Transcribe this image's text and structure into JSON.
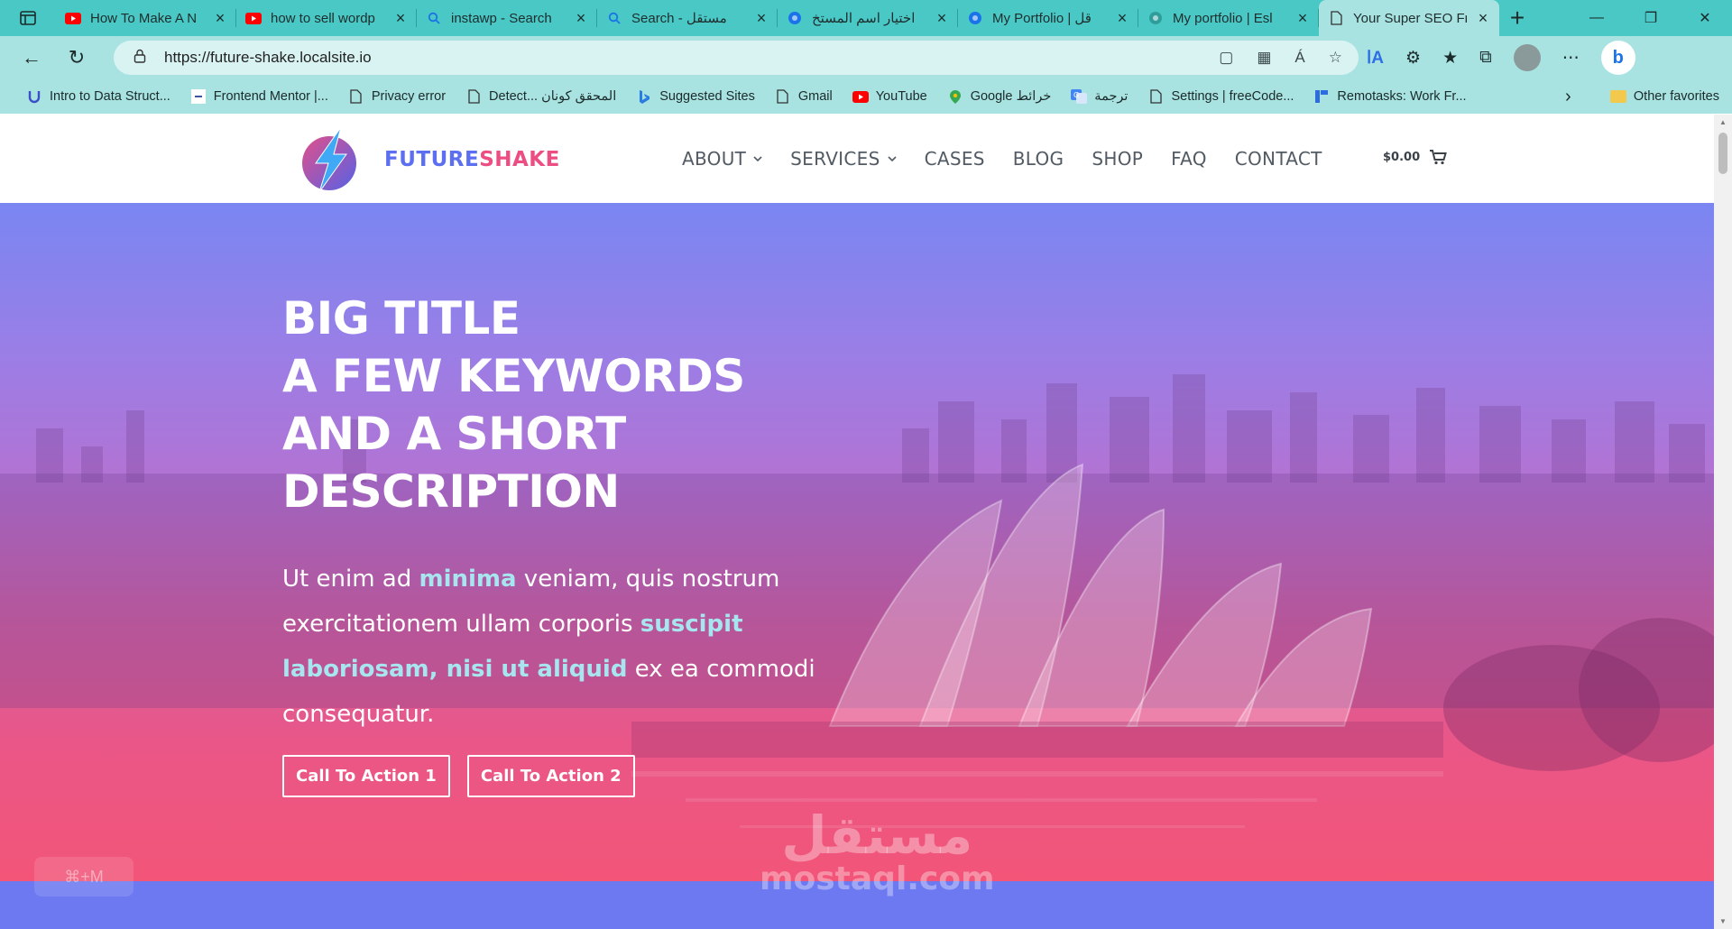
{
  "browser": {
    "tabs": [
      {
        "title": "How To Make A N",
        "icon": "youtube-icon",
        "color": "#ff0000"
      },
      {
        "title": "how to sell wordp",
        "icon": "youtube-icon",
        "color": "#ff0000"
      },
      {
        "title": "instawp - Search",
        "icon": "search-icon",
        "color": "#1a73e8"
      },
      {
        "title": "Search - مستقل",
        "icon": "search-icon",
        "color": "#1a73e8"
      },
      {
        "title": "اختيار اسم المستخ",
        "icon": "globe-icon",
        "color": "#1a73e8"
      },
      {
        "title": "My Portfolio | قل",
        "icon": "globe-icon",
        "color": "#1a73e8"
      },
      {
        "title": "My portfolio | Esl",
        "icon": "globe-icon",
        "color": "#2e9e9b"
      },
      {
        "title": "Your Super SEO Fr",
        "icon": "page-icon",
        "color": "#333333"
      }
    ],
    "active_tab_index": 7,
    "url": "https://future-shake.localsite.io",
    "bookmarks": [
      {
        "label": "Intro to Data Struct...",
        "icon": "u-logo-icon"
      },
      {
        "label": "Frontend Mentor |...",
        "icon": "frontend-mentor-icon"
      },
      {
        "label": "Privacy error",
        "icon": "page-icon"
      },
      {
        "label": "Detect... المحقق كونان",
        "icon": "page-icon"
      },
      {
        "label": "Suggested Sites",
        "icon": "bing-icon"
      },
      {
        "label": "Gmail",
        "icon": "page-icon"
      },
      {
        "label": "YouTube",
        "icon": "youtube-icon"
      },
      {
        "label": "Google خرائط",
        "icon": "maps-icon"
      },
      {
        "label": "ترجمة",
        "icon": "translate-icon"
      },
      {
        "label": "Settings | freeCode...",
        "icon": "page-icon"
      },
      {
        "label": "Remotasks: Work Fr...",
        "icon": "remotasks-icon"
      }
    ],
    "other_favorites": "Other favorites"
  },
  "site": {
    "logo": {
      "part1": "FUTURE",
      "part2": "SHAKE"
    },
    "nav": [
      {
        "label": "ABOUT",
        "dropdown": true
      },
      {
        "label": "SERVICES",
        "dropdown": true
      },
      {
        "label": "CASES",
        "dropdown": false
      },
      {
        "label": "BLOG",
        "dropdown": false
      },
      {
        "label": "SHOP",
        "dropdown": false
      },
      {
        "label": "FAQ",
        "dropdown": false
      },
      {
        "label": "CONTACT",
        "dropdown": false
      }
    ],
    "cart_total": "$0.00",
    "hero": {
      "title_lines": [
        "BIG TITLE",
        "A FEW KEYWORDS",
        "AND A SHORT",
        "DESCRIPTION"
      ],
      "text_parts": [
        {
          "t": "Ut enim ad ",
          "hl": false
        },
        {
          "t": "minima",
          "hl": true
        },
        {
          "t": " veniam, quis nostrum exercitationem ullam corporis ",
          "hl": false
        },
        {
          "t": "suscipit laboriosam, nisi ut aliquid",
          "hl": true
        },
        {
          "t": " ex ea commodi consequatur.",
          "hl": false
        }
      ],
      "cta1": "Call To Action 1",
      "cta2": "Call To Action 2"
    },
    "colors": {
      "brand_blue": "#5b6ff0",
      "brand_pink": "#ec4e83",
      "highlight": "#a7e6ef"
    }
  },
  "overlay": {
    "watermark_ar": "مستقل",
    "watermark_en": "mostaql.com",
    "shortcut": "⌘+M"
  }
}
